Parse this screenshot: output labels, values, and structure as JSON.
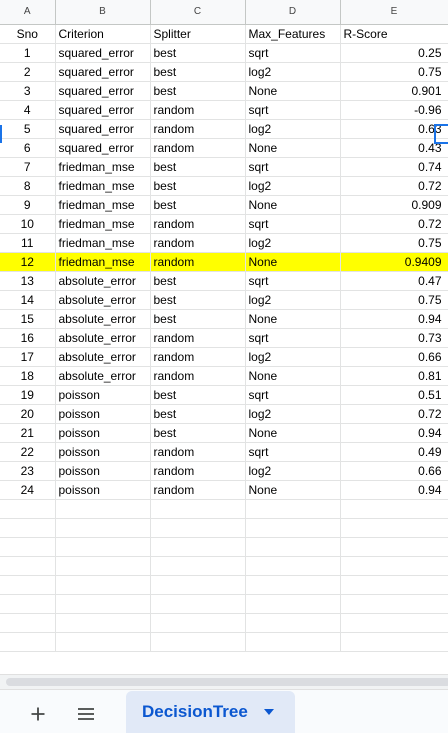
{
  "columns": [
    "A",
    "B",
    "C",
    "D",
    "E"
  ],
  "headers": [
    "Sno",
    "Criterion",
    "Splitter",
    "Max_Features",
    "R-Score"
  ],
  "rows": [
    [
      "1",
      "squared_error",
      "best",
      "sqrt",
      "0.25"
    ],
    [
      "2",
      "squared_error",
      "best",
      "log2",
      "0.75"
    ],
    [
      "3",
      "squared_error",
      "best",
      "None",
      "0.901"
    ],
    [
      "4",
      "squared_error",
      "random",
      "sqrt",
      "-0.96"
    ],
    [
      "5",
      "squared_error",
      "random",
      "log2",
      "0.63"
    ],
    [
      "6",
      "squared_error",
      "random",
      "None",
      "0.43"
    ],
    [
      "7",
      "friedman_mse",
      "best",
      "sqrt",
      "0.74"
    ],
    [
      "8",
      "friedman_mse",
      "best",
      "log2",
      "0.72"
    ],
    [
      "9",
      "friedman_mse",
      "best",
      "None",
      "0.909"
    ],
    [
      "10",
      "friedman_mse",
      "random",
      "sqrt",
      "0.72"
    ],
    [
      "11",
      "friedman_mse",
      "random",
      "log2",
      "0.75"
    ],
    [
      "12",
      "friedman_mse",
      "random",
      "None",
      "0.9409"
    ],
    [
      "13",
      "absolute_error",
      "best",
      "sqrt",
      "0.47"
    ],
    [
      "14",
      "absolute_error",
      "best",
      "log2",
      "0.75"
    ],
    [
      "15",
      "absolute_error",
      "best",
      "None",
      "0.94"
    ],
    [
      "16",
      "absolute_error",
      "random",
      "sqrt",
      "0.73"
    ],
    [
      "17",
      "absolute_error",
      "random",
      "log2",
      "0.66"
    ],
    [
      "18",
      "absolute_error",
      "random",
      "None",
      "0.81"
    ],
    [
      "19",
      "poisson",
      "best",
      "sqrt",
      "0.51"
    ],
    [
      "20",
      "poisson",
      "best",
      "log2",
      "0.72"
    ],
    [
      "21",
      "poisson",
      "best",
      "None",
      "0.94"
    ],
    [
      "22",
      "poisson",
      "random",
      "sqrt",
      "0.49"
    ],
    [
      "23",
      "poisson",
      "random",
      "log2",
      "0.66"
    ],
    [
      "24",
      "poisson",
      "random",
      "None",
      "0.94"
    ]
  ],
  "highlighted_row": 12,
  "highlight_color": "#ffff00",
  "sheet_tab": {
    "label": "DecisionTree",
    "active": true
  },
  "tabbar": {
    "add_icon": "plus-icon",
    "menu_icon": "hamburger-menu-icon",
    "caret_icon": "caret-down-icon"
  },
  "colors": {
    "accent": "#0b57d0",
    "selection": "#1a73e8",
    "tab_bg": "#e1e9f7"
  }
}
